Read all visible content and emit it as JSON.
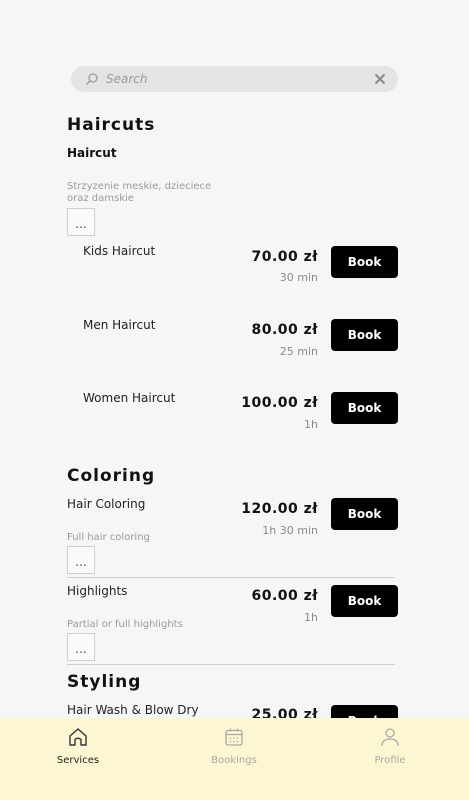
{
  "search": {
    "placeholder": "Search"
  },
  "categories": [
    {
      "title": "Haircuts",
      "group_title": "Haircut",
      "group_description": "Strzyzenie meskie, dzieciece oraz damskie",
      "more_label": "...",
      "services": [
        {
          "name": "Kids Haircut",
          "price": "70.00 zł",
          "duration": "30 min",
          "book_label": "Book"
        },
        {
          "name": "Men Haircut",
          "price": "80.00 zł",
          "duration": "25 min",
          "book_label": "Book"
        },
        {
          "name": "Women Haircut",
          "price": "100.00 zł",
          "duration": "1h",
          "book_label": "Book"
        }
      ]
    },
    {
      "title": "Coloring",
      "services": [
        {
          "name": "Hair Coloring",
          "description": "Full hair coloring",
          "more_label": "...",
          "price": "120.00 zł",
          "duration": "1h 30 min",
          "book_label": "Book"
        },
        {
          "name": "Highlights",
          "description": "Partial or full highlights",
          "more_label": "...",
          "price": "60.00 zł",
          "duration": "1h",
          "book_label": "Book"
        }
      ]
    },
    {
      "title": "Styling",
      "services": [
        {
          "name": "Hair Wash & Blow Dry",
          "price": "25.00 zł",
          "book_label": "Book"
        }
      ]
    }
  ],
  "tabbar": {
    "items": [
      {
        "label": "Services",
        "icon": "home-icon",
        "active": true
      },
      {
        "label": "Bookings",
        "icon": "calendar-icon",
        "active": false
      },
      {
        "label": "Profile",
        "icon": "user-icon",
        "active": false
      }
    ]
  },
  "colors": {
    "background": "#f5f6f8",
    "tabbar": "#fdf6d2",
    "button": "#000000",
    "inactive_tab": "#a9a9a9"
  }
}
